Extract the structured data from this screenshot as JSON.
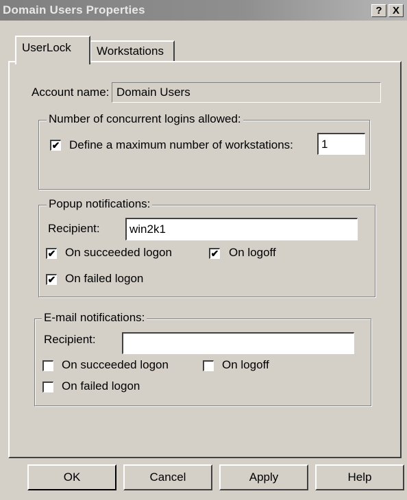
{
  "window": {
    "title": "Domain Users Properties",
    "help_button": "?",
    "close_button": "X"
  },
  "tabs": [
    {
      "label": "UserLock",
      "selected": true
    },
    {
      "label": "Workstations",
      "selected": false
    }
  ],
  "account": {
    "label": "Account name:",
    "value": "Domain Users"
  },
  "concurrent": {
    "legend": "Number of concurrent logins allowed:",
    "define_max_label": "Define a maximum number of workstations:",
    "define_max_checked": "✔",
    "max_value": "1"
  },
  "popup": {
    "legend": "Popup notifications:",
    "recipient_label": "Recipient:",
    "recipient_value": "win2k1",
    "on_succeeded_label": "On succeeded logon",
    "on_succeeded_checked": "✔",
    "on_logoff_label": "On logoff",
    "on_logoff_checked": "✔",
    "on_failed_label": "On failed logon",
    "on_failed_checked": "✔"
  },
  "email": {
    "legend": "E-mail notifications:",
    "recipient_label": "Recipient:",
    "recipient_value": "",
    "on_succeeded_label": "On succeeded logon",
    "on_logoff_label": "On logoff",
    "on_failed_label": "On failed logon"
  },
  "buttons": {
    "ok": "OK",
    "cancel": "Cancel",
    "apply": "Apply",
    "help": "Help"
  }
}
